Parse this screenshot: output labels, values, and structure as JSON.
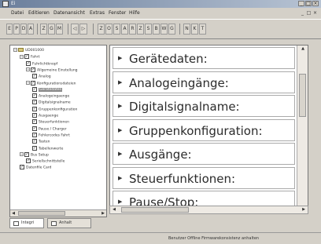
{
  "title": "Ei",
  "menu": [
    "Datei",
    "Editieren",
    "Datenansicht",
    "Extras",
    "Fenster",
    "Hilfe"
  ],
  "toolbar": {
    "groups": [
      [
        "E",
        "P",
        "D",
        "A"
      ],
      [
        "Z",
        "G",
        "M"
      ],
      [
        "◁",
        "▷"
      ],
      [
        "Z",
        "O",
        "S",
        "A",
        "R",
        "Z",
        "S",
        "B",
        "W",
        "G"
      ],
      [
        "N",
        "K",
        "T"
      ]
    ]
  },
  "tree": [
    {
      "label": "UD001000",
      "indent": 0,
      "expander": "−",
      "kind": "folder"
    },
    {
      "label": "Fahrt",
      "indent": 1,
      "expander": "−",
      "kind": "check"
    },
    {
      "label": "Fuhrlichtknopf",
      "indent": 2,
      "expander": "",
      "kind": "check"
    },
    {
      "label": "Allgemeine Einstellung",
      "indent": 2,
      "expander": "−",
      "kind": "check"
    },
    {
      "label": "Analog",
      "indent": 3,
      "expander": "",
      "kind": "check"
    },
    {
      "label": "Konfigurationsdateien",
      "indent": 2,
      "expander": "−",
      "kind": "check"
    },
    {
      "label": "Gerätedaten",
      "indent": 3,
      "expander": "",
      "kind": "check",
      "selected": true
    },
    {
      "label": "Analogeingaenge",
      "indent": 3,
      "expander": "",
      "kind": "check"
    },
    {
      "label": "Digitalsignalname",
      "indent": 3,
      "expander": "",
      "kind": "check"
    },
    {
      "label": "Gruppenkonfiguration",
      "indent": 3,
      "expander": "",
      "kind": "check"
    },
    {
      "label": "Ausgaenge",
      "indent": 3,
      "expander": "",
      "kind": "check"
    },
    {
      "label": "Steuerfunktionen",
      "indent": 3,
      "expander": "",
      "kind": "check"
    },
    {
      "label": "Pause / Charger",
      "indent": 3,
      "expander": "",
      "kind": "check"
    },
    {
      "label": "Fehlercodes Fahrt",
      "indent": 3,
      "expander": "",
      "kind": "check"
    },
    {
      "label": "Tasten",
      "indent": 3,
      "expander": "",
      "kind": "check"
    },
    {
      "label": "Tabellenwerte",
      "indent": 3,
      "expander": "",
      "kind": "check"
    },
    {
      "label": "Bus Setup",
      "indent": 1,
      "expander": "−",
      "kind": "check"
    },
    {
      "label": "Seriellschnittstelle",
      "indent": 2,
      "expander": "",
      "kind": "check"
    },
    {
      "label": "Datenfile Card",
      "indent": 1,
      "expander": "",
      "kind": "check"
    }
  ],
  "sections": [
    "Gerätedaten:",
    "Analogeingänge:",
    "Digitalsignalname:",
    "Gruppenkonfiguration:",
    "Ausgänge:",
    "Steuerfunktionen:",
    "Pause/Stop:"
  ],
  "tabs": [
    "Integri",
    "Anhalt"
  ],
  "status": "Benutzer Offline   Firmwarekonsistenz   anhalten"
}
